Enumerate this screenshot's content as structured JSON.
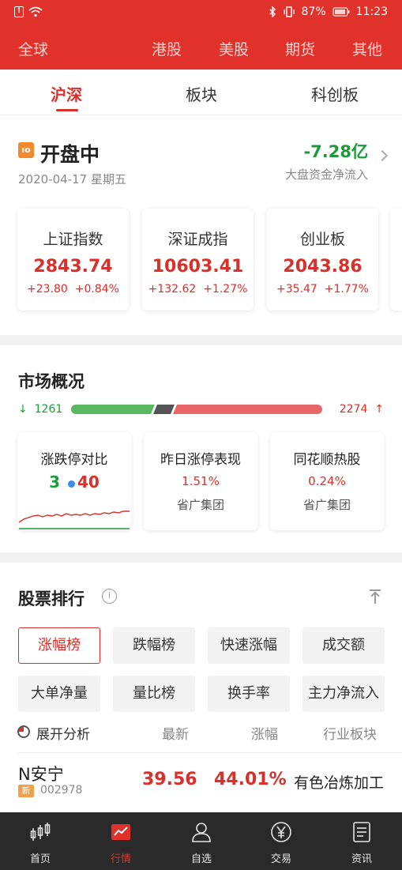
{
  "status_bar": {
    "battery": "87%",
    "time": "11:23",
    "sim_icon": "sim-alert-icon",
    "wifi_icon": "wifi-icon",
    "bluetooth_icon": "bluetooth-icon",
    "vibrate_icon": "vibrate-icon"
  },
  "markets": [
    "全球",
    "港股",
    "美股",
    "期货",
    "其他"
  ],
  "subtabs": [
    "沪深",
    "板块",
    "科创板"
  ],
  "open": {
    "title": "开盘中",
    "icon_text": "ıo",
    "date": "2020-04-17 星期五",
    "flow_value": "-7.28亿",
    "flow_label": "大盘资金净流入"
  },
  "indices": [
    {
      "name": "上证指数",
      "value": "2843.74",
      "change": "+23.80",
      "pct": "+0.84%"
    },
    {
      "name": "深证成指",
      "value": "10603.41",
      "change": "+132.62",
      "pct": "+1.27%"
    },
    {
      "name": "创业板",
      "value": "2043.86",
      "change": "+35.47",
      "pct": "+1.77%"
    }
  ],
  "overview": {
    "title": "市场概况",
    "down_count": "1261",
    "up_count": "2274",
    "down_arrow": "↓",
    "up_arrow": "↑",
    "cards": [
      {
        "title": "涨跌停对比",
        "ratio_left": "3",
        "ratio_right": "40"
      },
      {
        "title": "昨日涨停表现",
        "pct": "1.51%",
        "sub": "省广集团"
      },
      {
        "title": "同花顺热股",
        "pct": "0.24%",
        "sub": "省广集团"
      }
    ]
  },
  "ranking": {
    "title": "股票排行",
    "info_icon": "i",
    "buttons": [
      "涨幅榜",
      "跌幅榜",
      "快速涨幅",
      "成交额",
      "大单净量",
      "量比榜",
      "换手率",
      "主力净流入"
    ],
    "columns": {
      "expand": "展开分析",
      "latest": "最新",
      "change": "涨幅",
      "sector": "行业板块"
    },
    "row": {
      "name": "N安宁",
      "badge": "新",
      "code": "002978",
      "price": "39.56",
      "change": "44.01%",
      "sector": "有色冶炼加工"
    }
  },
  "bottom_nav": [
    {
      "label": "首页",
      "icon": "candlestick-icon"
    },
    {
      "label": "行情",
      "icon": "chart-trend-icon"
    },
    {
      "label": "自选",
      "icon": "person-icon"
    },
    {
      "label": "交易",
      "icon": "yen-icon"
    },
    {
      "label": "资讯",
      "icon": "news-icon"
    }
  ],
  "colors": {
    "brand_red": "#e0312b",
    "up": "#d8302a",
    "down": "#1d9a3a"
  }
}
